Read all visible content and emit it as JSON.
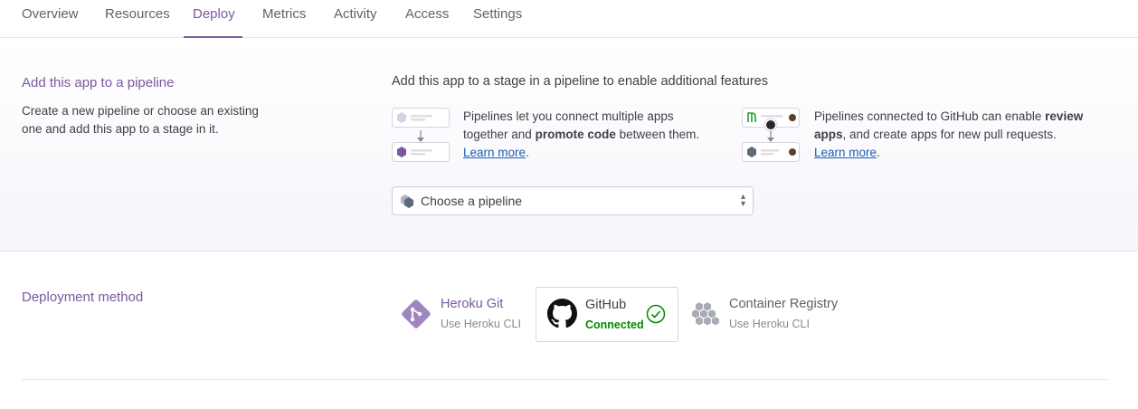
{
  "nav": {
    "tabs": [
      "Overview",
      "Resources",
      "Deploy",
      "Metrics",
      "Activity",
      "Access",
      "Settings"
    ],
    "active": "Deploy"
  },
  "pipeline": {
    "title": "Add this app to a pipeline",
    "description_line1": "Create a new pipeline or choose an existing",
    "description_line2": "one and add this app to a stage in it.",
    "heading": "Add this app to a stage in a pipeline to enable additional features",
    "feature1": {
      "line1": "Pipelines let you connect multiple apps",
      "line2_pre": "together and ",
      "line2_bold": "promote code",
      "line2_post": " between them.",
      "link": "Learn more",
      "link_suffix": "."
    },
    "feature2": {
      "line1_pre": "Pipelines connected to GitHub can enable ",
      "line1_bold": "review",
      "line2_bold": "apps",
      "line2_post": ", and create apps for new pull requests.",
      "link": "Learn more",
      "link_suffix": "."
    },
    "select": {
      "value": "Choose a pipeline",
      "icon": "pipeline-icon"
    }
  },
  "deployment": {
    "title": "Deployment method",
    "methods": [
      {
        "name": "Heroku Git",
        "sub": "Use Heroku CLI",
        "icon": "git-icon",
        "selected": false
      },
      {
        "name": "GitHub",
        "sub": "Connected",
        "icon": "github-icon",
        "selected": true,
        "status_icon": "check-circle-icon"
      },
      {
        "name": "Container Registry",
        "sub": "Use Heroku CLI",
        "icon": "container-icon",
        "selected": false
      }
    ]
  },
  "colors": {
    "accent": "#79589f",
    "link": "#1a5fb4",
    "connected": "#008a00"
  }
}
